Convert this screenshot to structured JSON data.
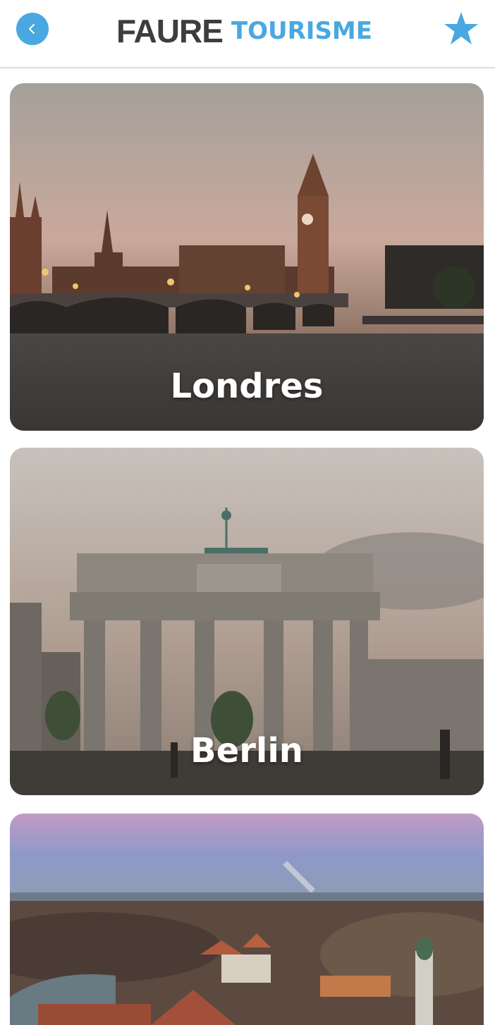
{
  "header": {
    "back_icon": "chevron-left-icon",
    "logo_text_1": "FAURE",
    "logo_text_2": "TOURISME",
    "favorite_icon": "star-icon",
    "accent_color": "#4aa8e0"
  },
  "destinations": [
    {
      "name": "Londres"
    },
    {
      "name": "Berlin"
    },
    {
      "name": ""
    }
  ]
}
